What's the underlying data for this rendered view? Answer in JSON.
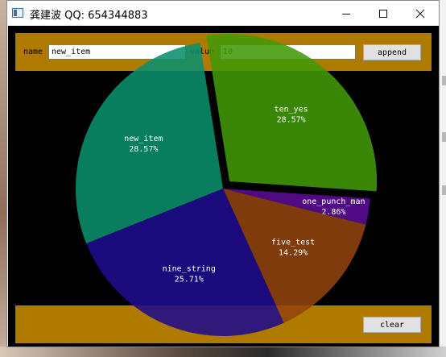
{
  "window": {
    "title": "龚建波 QQ: 654344883"
  },
  "controls": {
    "name_label": "name",
    "name_value": "new_item",
    "value_label": "value",
    "value_value": "10",
    "append_label": "append",
    "clear_label": "clear"
  },
  "chart_data": {
    "type": "pie",
    "slices": [
      {
        "name": "ten_yes",
        "percent": "28.57%",
        "value": 28.57,
        "color": "#429808"
      },
      {
        "name": "one_punch_man",
        "percent": "2.86%",
        "value": 2.86,
        "color": "#5b0d96"
      },
      {
        "name": "five_test",
        "percent": "14.29%",
        "value": 14.29,
        "color": "#92430e"
      },
      {
        "name": "nine_string",
        "percent": "25.71%",
        "value": 25.71,
        "color": "#1e0b8c"
      },
      {
        "name": "new_item",
        "percent": "28.57%",
        "value": 28.57,
        "color": "#0a906c"
      }
    ]
  },
  "colors": {
    "bar": "#b07a00",
    "background": "#000000"
  }
}
